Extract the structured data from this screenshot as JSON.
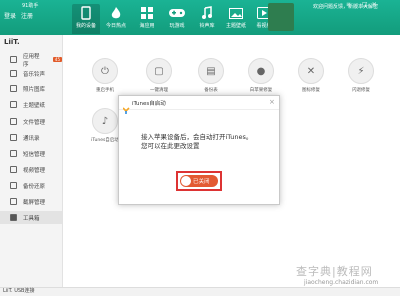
{
  "app": {
    "logo_text": "91助手",
    "login": "登录",
    "register": "注册"
  },
  "nav": [
    {
      "label": "我的设备",
      "icon": "phone-icon"
    },
    {
      "label": "今日热点",
      "icon": "fire-icon"
    },
    {
      "label": "海应用",
      "icon": "grid-icon"
    },
    {
      "label": "玩游戏",
      "icon": "gamepad-icon"
    },
    {
      "label": "铃声库",
      "icon": "music-icon"
    },
    {
      "label": "主题壁纸",
      "icon": "image-icon"
    },
    {
      "label": "看视频",
      "icon": "play-icon"
    }
  ],
  "ad_text": "欢迎问题反馈，新版本大解密",
  "device_name": "LiiT.",
  "sidebar": [
    {
      "label": "应用程序",
      "badge": "45"
    },
    {
      "label": "音乐铃声"
    },
    {
      "label": "照片图库"
    },
    {
      "label": "主题壁纸"
    },
    {
      "label": "文件管理"
    },
    {
      "label": "通讯录"
    },
    {
      "label": "短信管理"
    },
    {
      "label": "视频管理"
    },
    {
      "label": "备份还原"
    },
    {
      "label": "截屏管理"
    },
    {
      "label": "工具箱"
    }
  ],
  "tools": [
    {
      "label": "重启手机"
    },
    {
      "label": "一键清理"
    },
    {
      "label": "备份表"
    },
    {
      "label": "白苹果修复"
    },
    {
      "label": "图标修复"
    },
    {
      "label": "闪退修复"
    },
    {
      "label": "iTunes自启动"
    }
  ],
  "dialog": {
    "title": "iTunes自启动",
    "line1": "接入苹果设备后，会自动打开iTunes。",
    "line2": "您可以在此更改设置",
    "toggle_label": "已关闭"
  },
  "status": {
    "text": "LiiT.  USB连接"
  },
  "watermark": {
    "line1": "查字典|教程网",
    "line2": "jiaocheng.chazidian.com"
  }
}
